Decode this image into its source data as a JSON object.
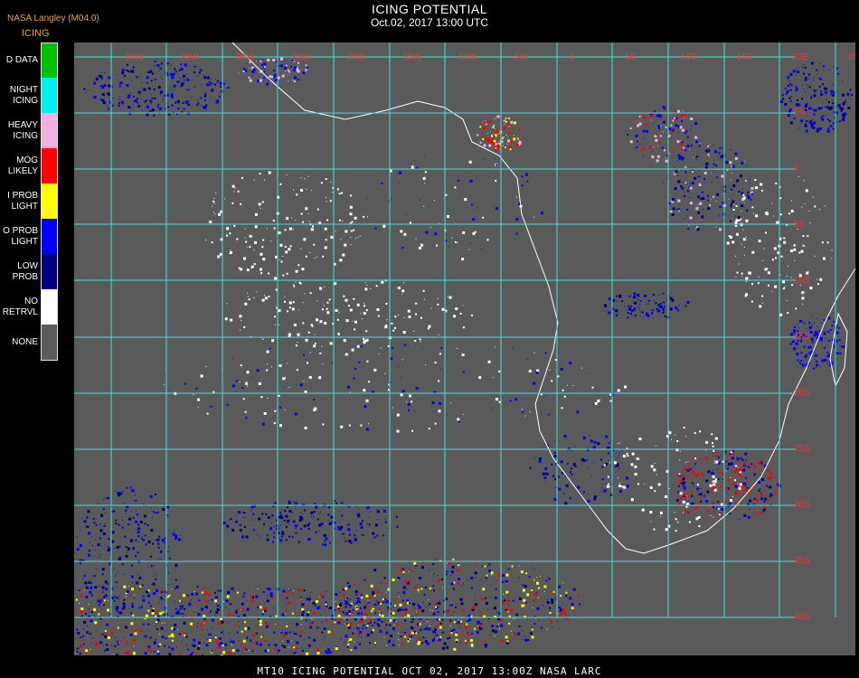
{
  "header": {
    "source": "NASA Langley (M04.0)",
    "product": "ICING",
    "title": "ICING POTENTIAL",
    "datetime": "Oct.02, 2017 13:00 UTC"
  },
  "legend": [
    {
      "label": "NO DATA",
      "display": "D DATA",
      "color": "#00c000"
    },
    {
      "label": "NIGHT ICING",
      "display": "NIGHT\nICING",
      "color": "#00f0f0"
    },
    {
      "label": "HEAVY ICING",
      "display": "HEAVY\nICING",
      "color": "#f0b0e0"
    },
    {
      "label": "MOG LIKELY",
      "display": "MOG\nLIKELY",
      "color": "#ff0000"
    },
    {
      "label": "HI PROB LIGHT",
      "display": "I PROB\nLIGHT",
      "color": "#ffff00"
    },
    {
      "label": "LO PROB LIGHT",
      "display": "O PROB\nLIGHT",
      "color": "#0000ff"
    },
    {
      "label": "LOW PROB",
      "display": "LOW\nPROB",
      "color": "#000080"
    },
    {
      "label": "NO RETRVL",
      "display": "NO\nRETRVL",
      "color": "#ffffff"
    },
    {
      "label": "NONE",
      "display": "NONE",
      "color": "#5a5a5a"
    }
  ],
  "map": {
    "background_color": "#5a5a5a",
    "grid_color": "#40e0e0",
    "coast_color": "#ffffff",
    "label_color": "#ff3030",
    "lon_labels": [
      "40W",
      "35W",
      "30W",
      "25W",
      "20W",
      "15W",
      "10W",
      "5W",
      "0",
      "5E",
      "10E",
      "15E",
      "20E",
      "25E",
      "30E",
      "35E",
      "40E"
    ],
    "lat_labels": [
      "5N",
      "0",
      "5S",
      "10S",
      "15S",
      "20S",
      "25S",
      "30S",
      "35S",
      "40S"
    ]
  },
  "footer": "MT10  ICING POTENTIAL   OCT 02, 2017 13:00Z  NASA LARC"
}
